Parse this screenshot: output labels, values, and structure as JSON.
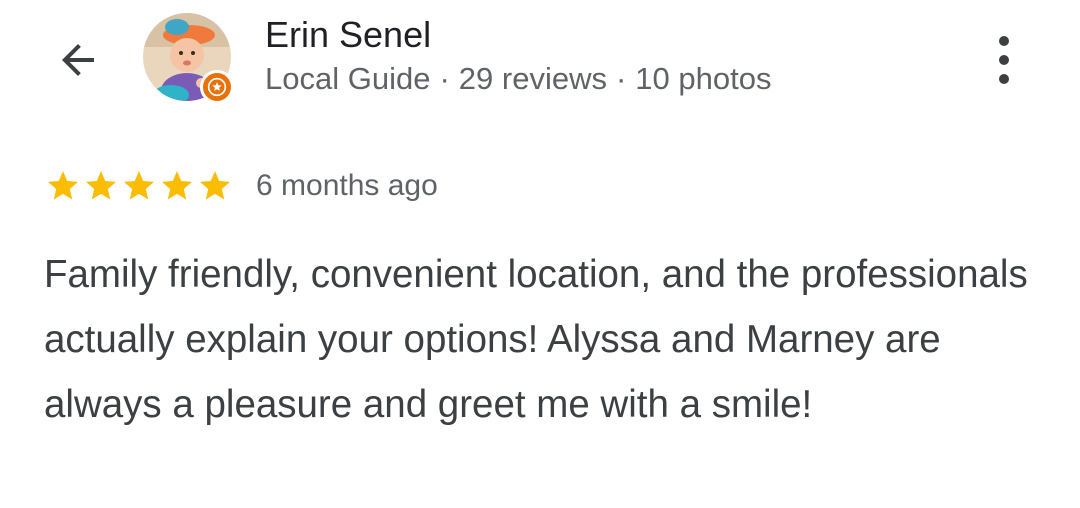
{
  "reviewer": {
    "name": "Erin Senel",
    "badge": "Local Guide",
    "reviews": "29 reviews",
    "photos": "10 photos",
    "separator": "·"
  },
  "review": {
    "rating": 5,
    "rating_max": 5,
    "time_ago": "6 months ago",
    "text": "Family friendly, convenient location, and the professionals actually explain your options! Alyssa and Marney are always a pleasure and greet me with a smile!"
  },
  "icons": {
    "back": "arrow-back-icon",
    "more": "more-vertical-icon",
    "star": "star-icon",
    "guide_badge": "local-guide-star-icon"
  },
  "colors": {
    "star": "#fbbc04",
    "badge": "#e8710a",
    "secondary_text": "#5f6368"
  }
}
